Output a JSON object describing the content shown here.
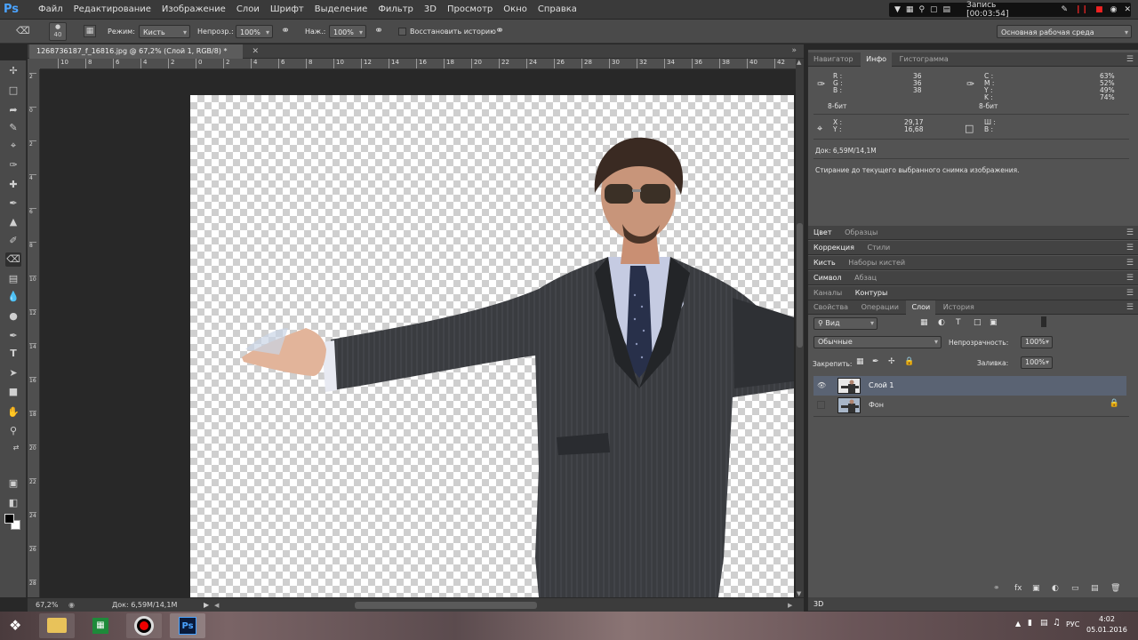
{
  "app": {
    "logo": "Ps"
  },
  "menu": [
    "Файл",
    "Редактирование",
    "Изображение",
    "Слои",
    "Шрифт",
    "Выделение",
    "Фильтр",
    "3D",
    "Просмотр",
    "Окно",
    "Справка"
  ],
  "recorder": {
    "label": "Запись [00:03:54]"
  },
  "options": {
    "brush_size": "40",
    "mode_label": "Режим:",
    "mode_value": "Кисть",
    "opacity_label": "Непрозр.:",
    "opacity_value": "100%",
    "flow_label": "Наж.:",
    "flow_value": "100%",
    "restore_history": "Восстановить историю",
    "workspace": "Основная рабочая среда"
  },
  "document": {
    "tab": "1268736187_f_16816.jpg @ 67,2% (Слой 1, RGB/8) *",
    "ruler_h": [
      "10",
      "8",
      "6",
      "4",
      "2",
      "0",
      "2",
      "4",
      "6",
      "8",
      "10",
      "12",
      "14",
      "16",
      "18",
      "20",
      "22",
      "24",
      "26",
      "28",
      "30",
      "32",
      "34",
      "36",
      "38",
      "40",
      "42"
    ],
    "ruler_v": [
      "2",
      "0",
      "2",
      "4",
      "6",
      "8",
      "1\n0",
      "1\n2",
      "1\n4",
      "1\n6",
      "1\n8",
      "2\n0",
      "2\n2",
      "2\n4",
      "2\n6",
      "2\n8"
    ],
    "zoom": "67,2%",
    "doc_size": "Док: 6,59M/14,1M"
  },
  "info_panel": {
    "tabs": [
      "Навигатор",
      "Инфо",
      "Гистограмма"
    ],
    "rgb": {
      "R": "36",
      "G": "36",
      "B": "38"
    },
    "cmyk": {
      "C": "63%",
      "M": "52%",
      "Y": "49%",
      "K": "74%"
    },
    "bits_left": "8-бит",
    "bits_right": "8-бит",
    "xy": {
      "X": "29,17",
      "Y": "16,68"
    },
    "wh": {
      "W": "",
      "H": ""
    },
    "doc": "Док: 6,59M/14,1M",
    "hint": "Стирание до текущего выбранного снимка изображения."
  },
  "panel_groups": [
    [
      "Цвет",
      "Образцы"
    ],
    [
      "Коррекция",
      "Стили"
    ],
    [
      "Кисть",
      "Наборы кистей"
    ],
    [
      "Символ",
      "Абзац"
    ],
    [
      "Каналы",
      "Контуры"
    ]
  ],
  "layers_panel": {
    "tabs": [
      "Свойства",
      "Операции",
      "Слои",
      "История"
    ],
    "filter": "Вид",
    "blend": "Обычные",
    "opacity_label": "Непрозрачность:",
    "opacity_value": "100%",
    "lock_label": "Закрепить:",
    "fill_label": "Заливка:",
    "fill_value": "100%",
    "layers": [
      {
        "name": "Слой 1"
      },
      {
        "name": "Фон"
      }
    ],
    "bottom_tab": "3D"
  },
  "taskbar": {
    "lang": "РУС",
    "time": "4:02",
    "date": "05.01.2016"
  }
}
